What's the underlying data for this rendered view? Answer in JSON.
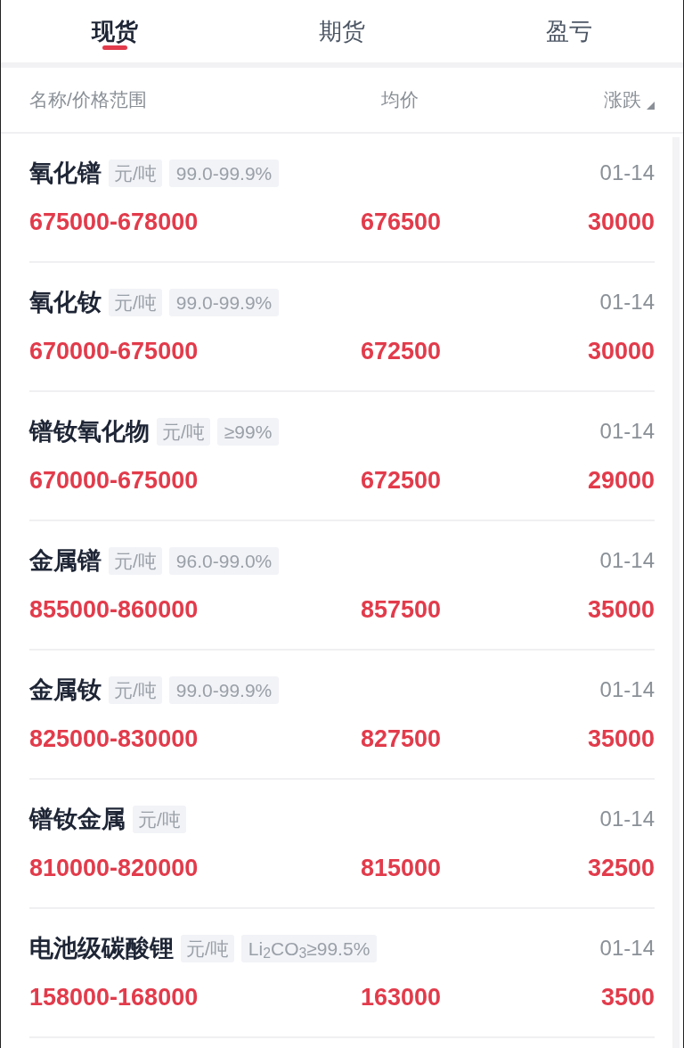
{
  "tabs": [
    {
      "label": "现货",
      "selected": true
    },
    {
      "label": "期货",
      "selected": false
    },
    {
      "label": "盈亏",
      "selected": false
    }
  ],
  "columns": {
    "name": "名称/价格范围",
    "avg": "均价",
    "change": "涨跌"
  },
  "rows": [
    {
      "name": "氧化镨",
      "unit": "元/吨",
      "purity": "99.0-99.9%",
      "date": "01-14",
      "range": "675000-678000",
      "avg": "676500",
      "change": "30000"
    },
    {
      "name": "氧化钕",
      "unit": "元/吨",
      "purity": "99.0-99.9%",
      "date": "01-14",
      "range": "670000-675000",
      "avg": "672500",
      "change": "30000"
    },
    {
      "name": "镨钕氧化物",
      "unit": "元/吨",
      "purity": "≥99%",
      "date": "01-14",
      "range": "670000-675000",
      "avg": "672500",
      "change": "29000"
    },
    {
      "name": "金属镨",
      "unit": "元/吨",
      "purity": "96.0-99.0%",
      "date": "01-14",
      "range": "855000-860000",
      "avg": "857500",
      "change": "35000"
    },
    {
      "name": "金属钕",
      "unit": "元/吨",
      "purity": "99.0-99.9%",
      "date": "01-14",
      "range": "825000-830000",
      "avg": "827500",
      "change": "35000"
    },
    {
      "name": "镨钕金属",
      "unit": "元/吨",
      "date": "01-14",
      "range": "810000-820000",
      "avg": "815000",
      "change": "32500"
    },
    {
      "name": "电池级碳酸锂",
      "unit": "元/吨",
      "purity": "Li$_{2}$CO$_{3}$≥99.5%",
      "date": "01-14",
      "range": "158000-168000",
      "avg": "163000",
      "change": "3500"
    }
  ]
}
